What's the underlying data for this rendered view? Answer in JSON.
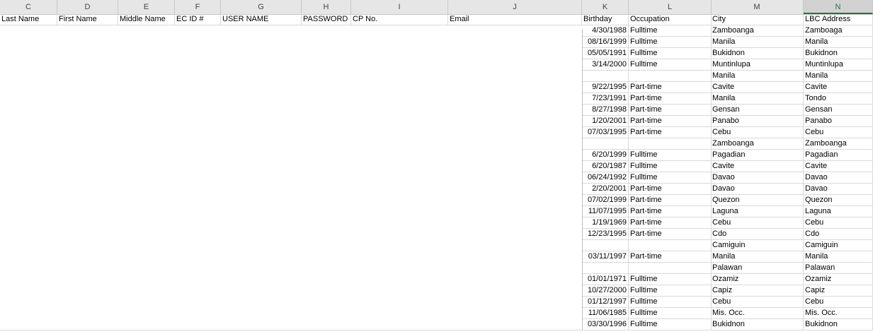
{
  "columns": [
    {
      "letter": "C",
      "header": "Last Name"
    },
    {
      "letter": "D",
      "header": "First Name"
    },
    {
      "letter": "E",
      "header": "Middle Name"
    },
    {
      "letter": "F",
      "header": "EC ID #"
    },
    {
      "letter": "G",
      "header": "USER NAME"
    },
    {
      "letter": "H",
      "header": "PASSWORD"
    },
    {
      "letter": "I",
      "header": "CP No."
    },
    {
      "letter": "J",
      "header": "Email"
    },
    {
      "letter": "K",
      "header": "Birthday"
    },
    {
      "letter": "L",
      "header": "Occupation"
    },
    {
      "letter": "M",
      "header": "City"
    },
    {
      "letter": "N",
      "header": "LBC Address"
    }
  ],
  "selected_column": "N",
  "rows": [
    {
      "birthday": "4/30/1988",
      "occupation": "Fulltime",
      "city": "Zamboanga",
      "lbc": " Zamboaga"
    },
    {
      "birthday": "08/16/1999",
      "occupation": "Fulltime",
      "city": "Manila",
      "lbc": "Manila"
    },
    {
      "birthday": "05/05/1991",
      "occupation": "Fulltime",
      "city": "Bukidnon",
      "lbc": "Bukidnon"
    },
    {
      "birthday": "3/14/2000",
      "occupation": "Fulltime",
      "city": "Muntinlupa",
      "lbc": "Muntinlupa"
    },
    {
      "birthday": "",
      "occupation": "",
      "city": "Manila",
      "lbc": "Manila"
    },
    {
      "birthday": "9/22/1995",
      "occupation": "Part-time",
      "city": "Cavite",
      "lbc": "Cavite"
    },
    {
      "birthday": "7/23/1991",
      "occupation": "Part-time",
      "city": "Manila",
      "lbc": "Tondo"
    },
    {
      "birthday": "8/27/1998",
      "occupation": "Part-time",
      "city": "Gensan",
      "lbc": "Gensan"
    },
    {
      "birthday": "1/20/2001",
      "occupation": "Part-time",
      "city": "Panabo",
      "lbc": "Panabo"
    },
    {
      "birthday": "07/03/1995",
      "occupation": "Part-time",
      "city": "Cebu",
      "lbc": "Cebu"
    },
    {
      "birthday": "",
      "occupation": "",
      "city": "Zamboanga",
      "lbc": "Zamboanga"
    },
    {
      "birthday": "6/20/1999",
      "occupation": "Fulltime",
      "city": "Pagadian",
      "lbc": "Pagadian"
    },
    {
      "birthday": "6/20/1987",
      "occupation": "Fulltime",
      "city": "Cavite",
      "lbc": "Cavite"
    },
    {
      "birthday": "06/24/1992",
      "occupation": "Fulltime",
      "city": "Davao",
      "lbc": "Davao"
    },
    {
      "birthday": "2/20/2001",
      "occupation": "Part-time",
      "city": "Davao",
      "lbc": "Davao"
    },
    {
      "birthday": "07/02/1999",
      "occupation": "Part-time",
      "city": "Quezon",
      "lbc": "Quezon"
    },
    {
      "birthday": "11/07/1995",
      "occupation": "Part-time",
      "city": "Laguna",
      "lbc": "Laguna"
    },
    {
      "birthday": "1/19/1969",
      "occupation": "Part-time",
      "city": "Cebu",
      "lbc": "Cebu"
    },
    {
      "birthday": "12/23/1995",
      "occupation": "Part-time",
      "city": "Cdo",
      "lbc": "Cdo"
    },
    {
      "birthday": "",
      "occupation": "",
      "city": "Camiguin",
      "lbc": "Camiguin"
    },
    {
      "birthday": "03/11/1997",
      "occupation": "Part-time",
      "city": "Manila",
      "lbc": "Manila"
    },
    {
      "birthday": "",
      "occupation": "",
      "city": "Palawan",
      "lbc": "Palawan"
    },
    {
      "birthday": "01/01/1971",
      "occupation": "Fulltime",
      "city": "Ozamiz",
      "lbc": "Ozamiz"
    },
    {
      "birthday": "10/27/2000",
      "occupation": "Fulltime",
      "city": "Capiz",
      "lbc": "Capiz"
    },
    {
      "birthday": "01/12/1997",
      "occupation": "Fulltime",
      "city": "Cebu",
      "lbc": "Cebu"
    },
    {
      "birthday": "11/06/1985",
      "occupation": "Fulltime",
      "city": "Mis. Occ.",
      "lbc": "Mis. Occ."
    },
    {
      "birthday": "03/30/1996",
      "occupation": "Fulltime",
      "city": "Bukidnon",
      "lbc": "Bukidnon"
    }
  ]
}
